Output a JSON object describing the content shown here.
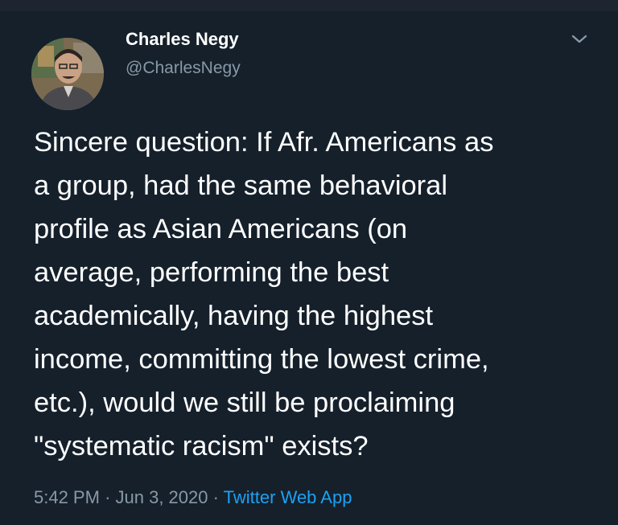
{
  "tweet": {
    "author": {
      "display_name": "Charles Negy",
      "handle": "@CharlesNegy",
      "avatar_icon": "profile-photo"
    },
    "menu_icon": "chevron-down-icon",
    "text_lines": [
      "Sincere question: If Afr. Americans as",
      "a group, had the same behavioral",
      "profile as Asian Americans (on",
      "average, performing the best",
      "academically, having the highest",
      "income, committing the lowest crime,",
      "etc.), would we still be proclaiming",
      "\"systematic racism\" exists?"
    ],
    "time": "5:42 PM",
    "date": "Jun 3, 2020",
    "separator": "·",
    "source": "Twitter Web App"
  },
  "colors": {
    "background": "#15202b",
    "text": "#ffffff",
    "secondary_text": "#8899a6",
    "link": "#1da1f2"
  }
}
